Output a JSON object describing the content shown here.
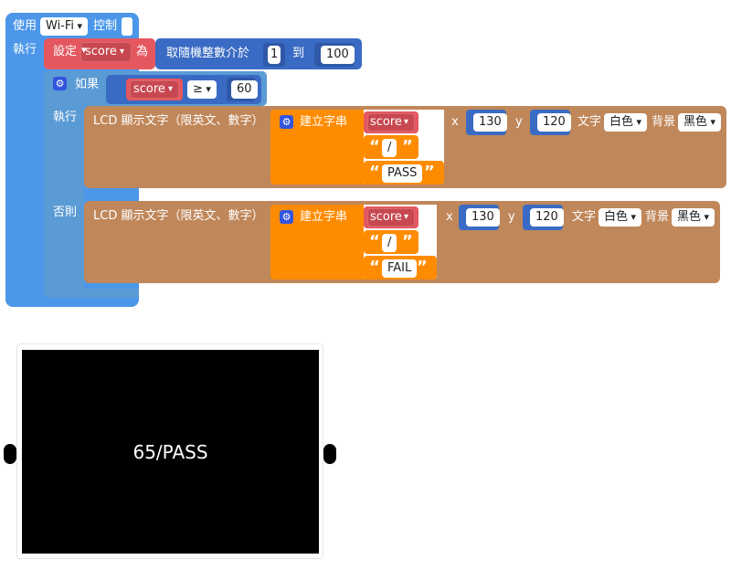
{
  "wifi_block": {
    "prefix": "使用",
    "device": "Wi-Fi",
    "suffix": "控制"
  },
  "main_block": {
    "exec_label": "執行"
  },
  "set_block": {
    "label": "設定",
    "variable": "score",
    "suffix": "為"
  },
  "random_block": {
    "label": "取隨機整數介於",
    "from": "1",
    "to_label": "到",
    "to": "100"
  },
  "if_block": {
    "label": "如果",
    "variable": "score",
    "operator": "≥",
    "value": "60",
    "then_label": "執行",
    "else_label": "否則"
  },
  "lcd_pass": {
    "label": "LCD 顯示文字（限英文、數字）",
    "build_label": "建立字串",
    "variable": "score",
    "sep": "/",
    "text": "PASS",
    "x_label": "x",
    "x": "130",
    "y_label": "y",
    "y": "120",
    "color_label": "文字",
    "color": "白色",
    "bg_label": "背景",
    "bg": "黑色"
  },
  "lcd_fail": {
    "label": "LCD 顯示文字（限英文、數字）",
    "build_label": "建立字串",
    "variable": "score",
    "sep": "/",
    "text": "FAIL",
    "x_label": "x",
    "x": "130",
    "y_label": "y",
    "y": "120",
    "color_label": "文字",
    "color": "白色",
    "bg_label": "背景",
    "bg": "黑色"
  },
  "preview": {
    "display_text": "65/PASS"
  },
  "colors": {
    "wifi_blue": "#4c97ea",
    "set_red": "#e4575f",
    "math_blue": "#3a6bc4",
    "logic_blue": "#5b9bd5",
    "lcd_brown": "#c0875a",
    "text_orange": "#ff8c00"
  }
}
